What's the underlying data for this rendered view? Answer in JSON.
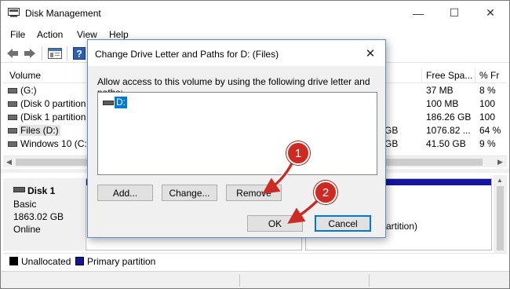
{
  "window": {
    "title": "Disk Management",
    "minimize": "—",
    "maximize": "☐",
    "close": "✕"
  },
  "menu": [
    "File",
    "Action",
    "View",
    "Help"
  ],
  "volume_table": {
    "headers": [
      "Volume",
      "Free Spa...",
      "% Fr"
    ],
    "rows": [
      {
        "name": "(G:)",
        "c1": "",
        "c2": "37 MB",
        "c3": "8 %"
      },
      {
        "name": "(Disk 0 partition",
        "c1": "",
        "c2": "100 MB",
        "c3": "100"
      },
      {
        "name": "(Disk 1 partition",
        "c1": "",
        "c2": "186.26 GB",
        "c3": "100"
      },
      {
        "name": "Files (D:)",
        "c1": "GB",
        "c2": "1076.82 ...",
        "c3": "64 %"
      },
      {
        "name": "Windows 10 (C:)",
        "c1": "GB",
        "c2": "41.50 GB",
        "c3": "9 %"
      }
    ]
  },
  "disk": {
    "name": "Disk 1",
    "type": "Basic",
    "size": "1863.02 GB",
    "status": "Online",
    "partition_text": "Partition)"
  },
  "legend": {
    "unallocated": "Unallocated",
    "primary": "Primary partition",
    "unallocated_color": "#000000",
    "primary_color": "#15159d"
  },
  "dialog": {
    "title": "Change Drive Letter and Paths for D: (Files)",
    "close": "✕",
    "description": "Allow access to this volume by using the following drive letter and paths:",
    "list_items": [
      "D:"
    ],
    "buttons": {
      "add": "Add...",
      "change": "Change...",
      "remove": "Remove",
      "ok": "OK",
      "cancel": "Cancel"
    }
  },
  "annotations": {
    "step1": "1",
    "step2": "2",
    "color": "#cc2a22"
  }
}
